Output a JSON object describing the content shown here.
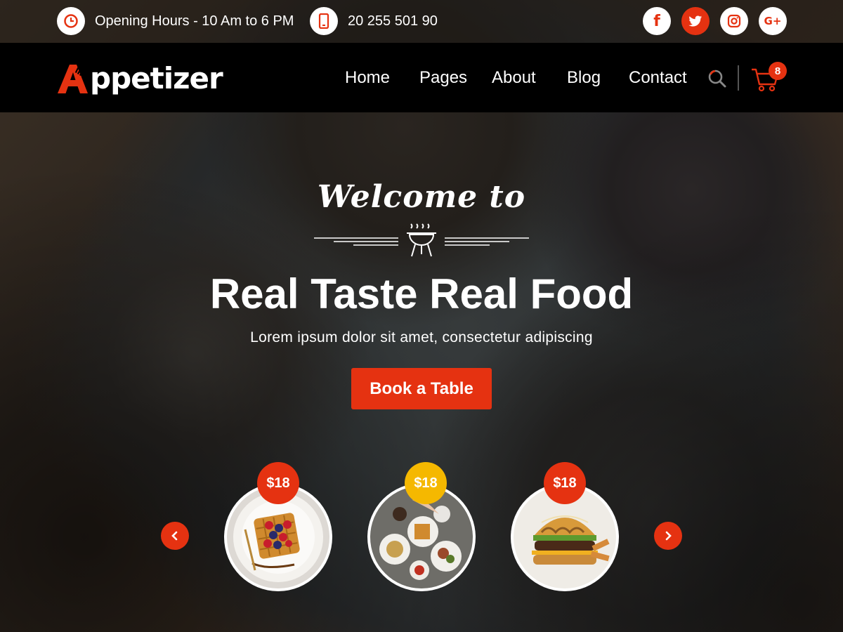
{
  "topbar": {
    "hours_text": "Opening Hours - 10 Am to 6 PM",
    "hours_icon": "clock-icon",
    "phone_text": "20 255 501 90",
    "phone_icon": "mobile-phone-icon",
    "social": [
      {
        "name": "facebook",
        "glyph": "f"
      },
      {
        "name": "twitter",
        "glyph": ""
      },
      {
        "name": "instagram",
        "glyph": ""
      },
      {
        "name": "google-plus",
        "glyph": "G+"
      }
    ]
  },
  "nav": {
    "logo_rest": "ppetizer",
    "links": [
      "Home",
      "Pages",
      "About",
      "Blog",
      "Contact"
    ],
    "cart_count": "8"
  },
  "hero": {
    "script": "Welcome to",
    "title": "Real Taste Real Food",
    "subtitle": "Lorem ipsum dolor sit amet, consectetur adipiscing",
    "button": "Book a Table"
  },
  "carousel": {
    "items": [
      {
        "price": "$18",
        "badge_color": "#e53211",
        "dish": "waffle-plate"
      },
      {
        "price": "$18",
        "badge_color": "#f5b800",
        "dish": "table-spread"
      },
      {
        "price": "$18",
        "badge_color": "#e53211",
        "dish": "burger"
      }
    ]
  },
  "colors": {
    "accent": "#e53211",
    "secondary": "#f5b800",
    "nav_bg": "#000000"
  }
}
